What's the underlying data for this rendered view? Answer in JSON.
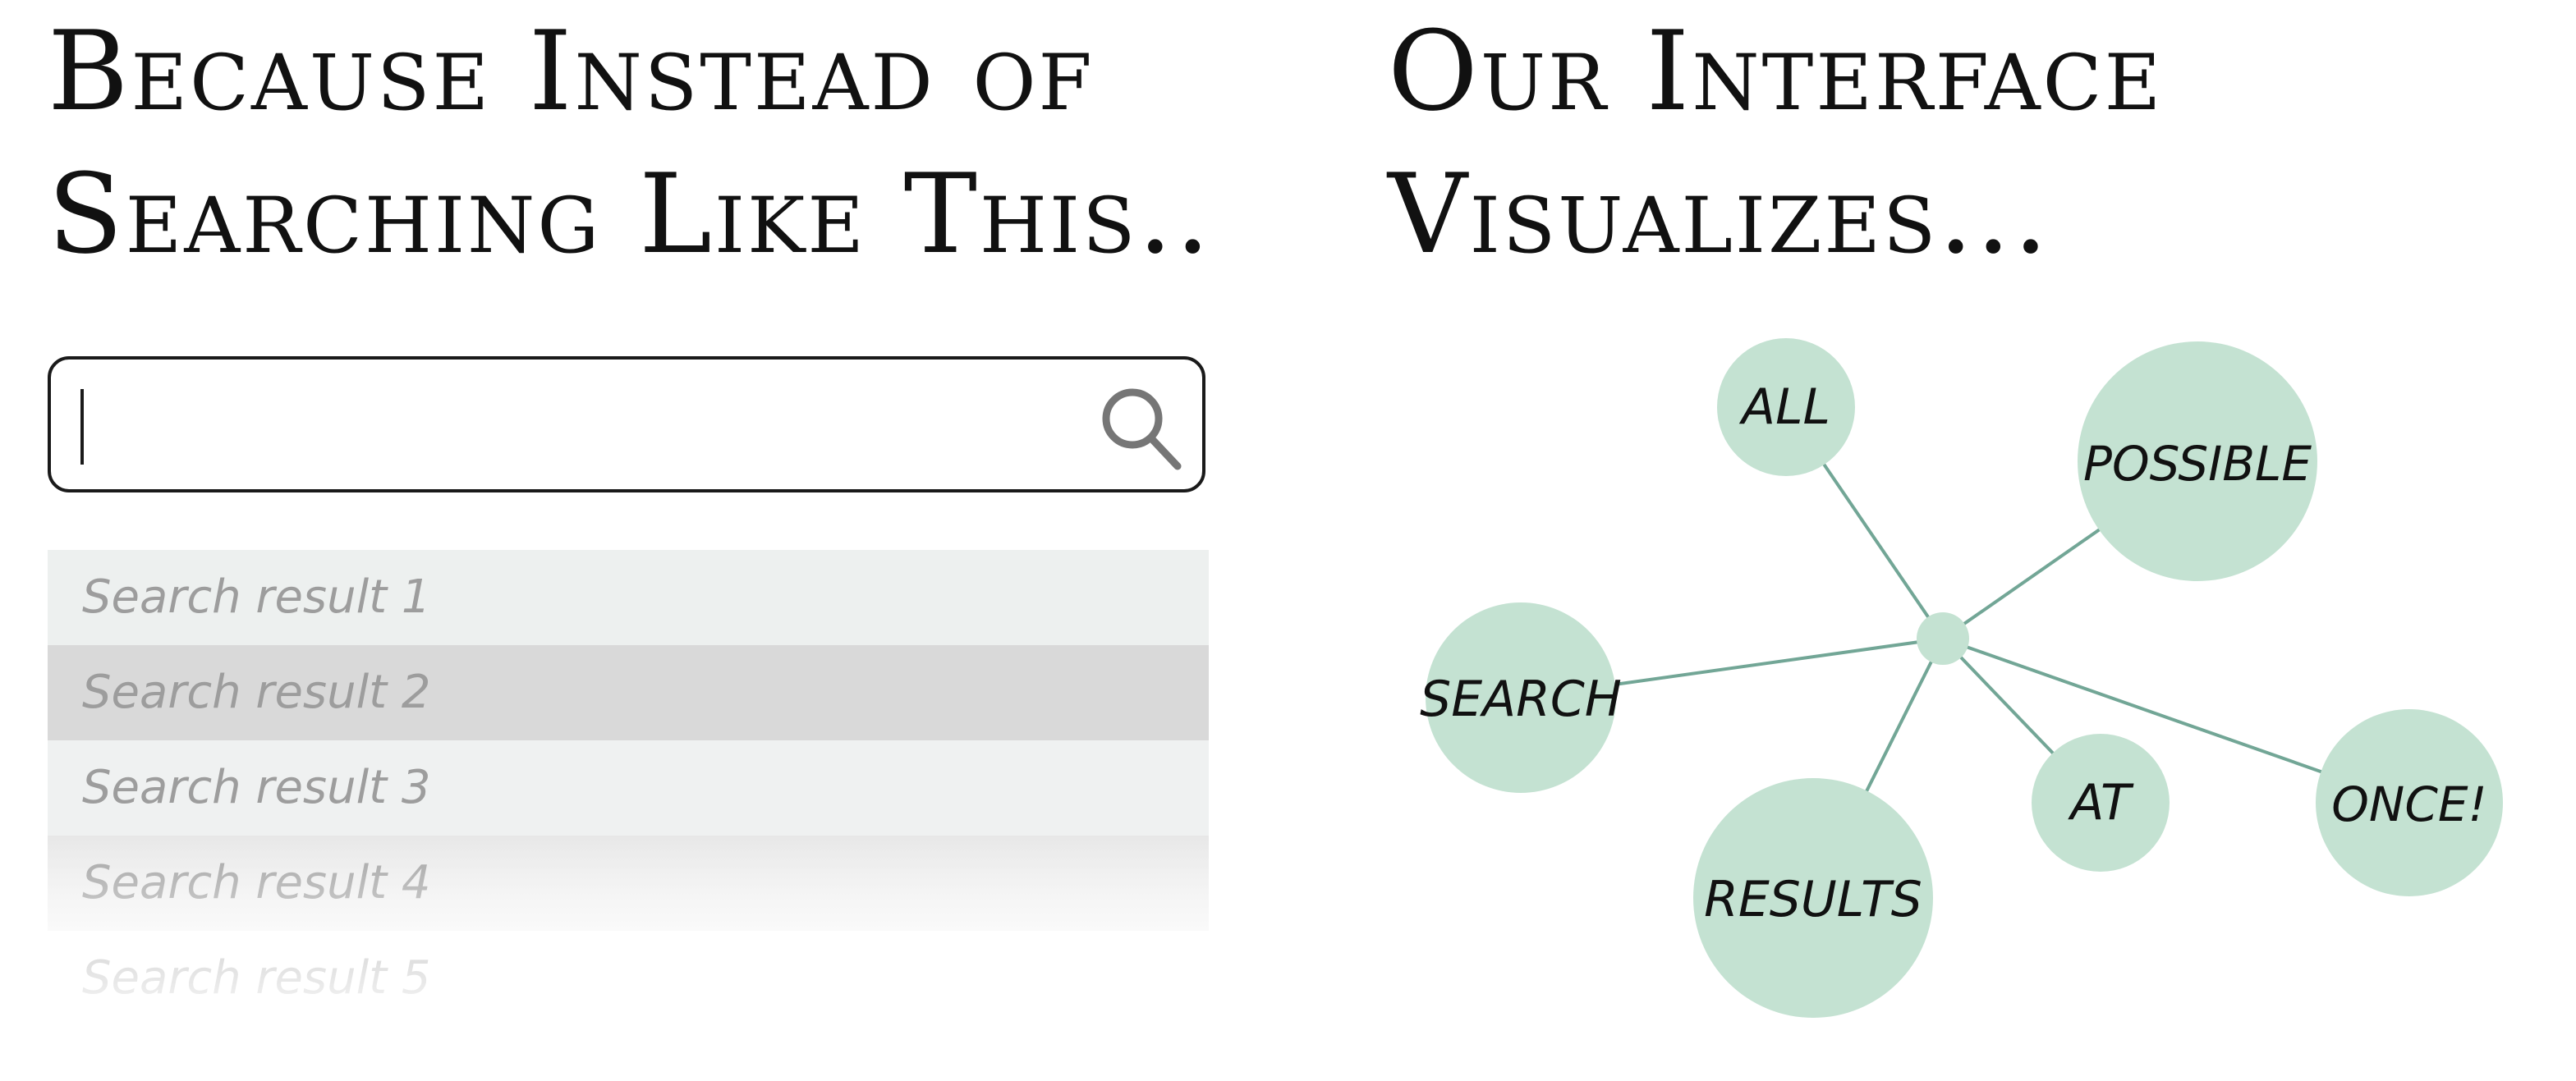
{
  "left_heading": {
    "line1": "Because Instead of",
    "line2": "Searching Like This.."
  },
  "right_heading": {
    "line1": "Our Interface",
    "line2": "Visualizes..."
  },
  "search": {
    "value": "",
    "icon": "search-icon"
  },
  "results": [
    "Search result 1",
    "Search result 2",
    "Search result 3",
    "Search result 4",
    "Search result 5"
  ],
  "network": {
    "hub": "hub",
    "nodes": [
      "ALL",
      "POSSIBLE",
      "SEARCH",
      "AT",
      "ONCE!",
      "RESULTS"
    ],
    "colors": {
      "node_fill": "#c4e2d2",
      "edge": "#72a696"
    }
  }
}
